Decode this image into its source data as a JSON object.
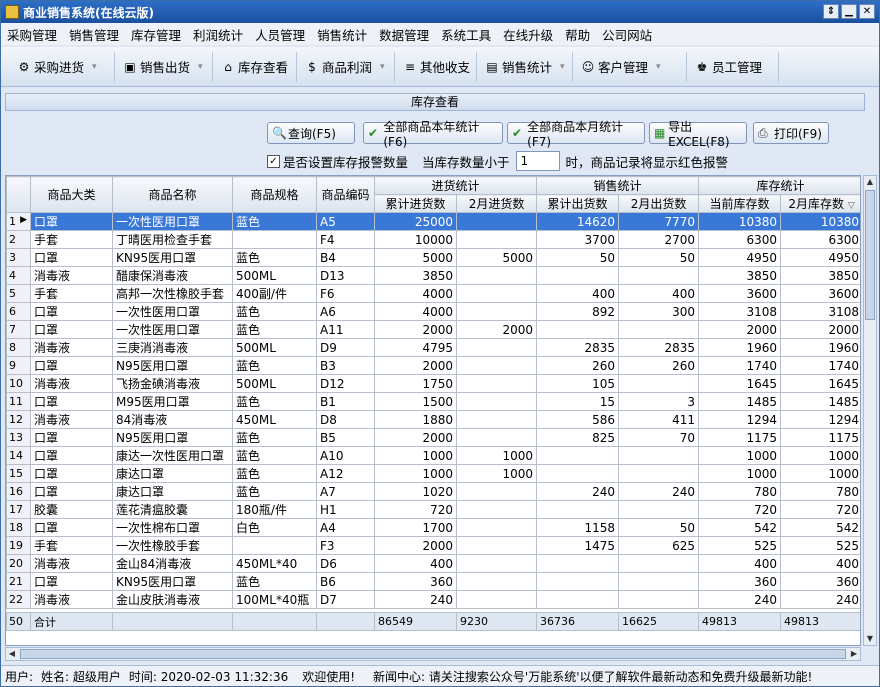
{
  "window": {
    "title": "商业销售系统(在线云版)"
  },
  "menu": [
    "采购管理",
    "销售管理",
    "库存管理",
    "利润统计",
    "人员管理",
    "销售统计",
    "数据管理",
    "系统工具",
    "在线升级",
    "帮助",
    "公司网站"
  ],
  "toolbar": [
    {
      "label": "采购进货",
      "icon": "purchase-icon",
      "glyph": "⚙",
      "dropdown": true
    },
    {
      "label": "销售出货",
      "icon": "sales-icon",
      "glyph": "▣",
      "dropdown": true
    },
    {
      "label": "库存查看",
      "icon": "inventory-icon",
      "glyph": "⌂",
      "dropdown": false
    },
    {
      "label": "商品利润",
      "icon": "profit-icon",
      "glyph": "$",
      "dropdown": true
    },
    {
      "label": "其他收支",
      "icon": "other-io-icon",
      "glyph": "≡",
      "dropdown": false
    },
    {
      "label": "销售统计",
      "icon": "stats-icon",
      "glyph": "▤",
      "dropdown": true
    },
    {
      "label": "客户管理",
      "icon": "customer-icon",
      "glyph": "☺",
      "dropdown": true
    },
    {
      "label": "员工管理",
      "icon": "staff-icon",
      "glyph": "♚",
      "dropdown": false
    }
  ],
  "panel": {
    "title": "库存查看"
  },
  "actions": {
    "query": "查询(F5)",
    "year_stats": "全部商品本年统计(F6)",
    "month_stats": "全部商品本月统计(F7)",
    "export": "导出EXCEL(F8)",
    "print": "打印(F9)"
  },
  "options": {
    "alarm_checkbox_label": "是否设置库存报警数量",
    "alarm_checked": true,
    "threshold_prefix": "当库存数量小于",
    "threshold_value": "1",
    "threshold_suffix": "时，商品记录将显示红色报警"
  },
  "table": {
    "group_headers": [
      "进货统计",
      "销售统计",
      "库存统计"
    ],
    "headers": [
      "商品大类",
      "商品名称",
      "商品规格",
      "商品编码",
      "累计进货数",
      "2月进货数",
      "累计出货数",
      "2月出货数",
      "当前库存数",
      "2月库存数"
    ],
    "rows": [
      [
        "1",
        "口罩",
        "一次性医用口罩",
        "蓝色",
        "A5",
        "25000",
        "",
        "14620",
        "7770",
        "10380",
        "10380"
      ],
      [
        "2",
        "手套",
        "丁晴医用检查手套",
        "",
        "F4",
        "10000",
        "",
        "3700",
        "2700",
        "6300",
        "6300"
      ],
      [
        "3",
        "口罩",
        "KN95医用口罩",
        "蓝色",
        "B4",
        "5000",
        "5000",
        "50",
        "50",
        "4950",
        "4950"
      ],
      [
        "4",
        "消毒液",
        "醋康保消毒液",
        "500ML",
        "D13",
        "3850",
        "",
        "",
        "",
        "3850",
        "3850"
      ],
      [
        "5",
        "手套",
        "高邦一次性橡胶手套",
        "400副/件",
        "F6",
        "4000",
        "",
        "400",
        "400",
        "3600",
        "3600"
      ],
      [
        "6",
        "口罩",
        "一次性医用口罩",
        "蓝色",
        "A6",
        "4000",
        "",
        "892",
        "300",
        "3108",
        "3108"
      ],
      [
        "7",
        "口罩",
        "一次性医用口罩",
        "蓝色",
        "A11",
        "2000",
        "2000",
        "",
        "",
        "2000",
        "2000"
      ],
      [
        "8",
        "消毒液",
        "三庚消消毒液",
        "500ML",
        "D9",
        "4795",
        "",
        "2835",
        "2835",
        "1960",
        "1960"
      ],
      [
        "9",
        "口罩",
        "N95医用口罩",
        "蓝色",
        "B3",
        "2000",
        "",
        "260",
        "260",
        "1740",
        "1740"
      ],
      [
        "10",
        "消毒液",
        "飞扬金碘消毒液",
        "500ML",
        "D12",
        "1750",
        "",
        "105",
        "",
        "1645",
        "1645"
      ],
      [
        "11",
        "口罩",
        "M95医用口罩",
        "蓝色",
        "B1",
        "1500",
        "",
        "15",
        "3",
        "1485",
        "1485"
      ],
      [
        "12",
        "消毒液",
        "84消毒液",
        "450ML",
        "D8",
        "1880",
        "",
        "586",
        "411",
        "1294",
        "1294"
      ],
      [
        "13",
        "口罩",
        "N95医用口罩",
        "蓝色",
        "B5",
        "2000",
        "",
        "825",
        "70",
        "1175",
        "1175"
      ],
      [
        "14",
        "口罩",
        "康达一次性医用口罩",
        "蓝色",
        "A10",
        "1000",
        "1000",
        "",
        "",
        "1000",
        "1000"
      ],
      [
        "15",
        "口罩",
        "康达口罩",
        "蓝色",
        "A12",
        "1000",
        "1000",
        "",
        "",
        "1000",
        "1000"
      ],
      [
        "16",
        "口罩",
        "康达口罩",
        "蓝色",
        "A7",
        "1020",
        "",
        "240",
        "240",
        "780",
        "780"
      ],
      [
        "17",
        "胶囊",
        "莲花清瘟胶囊",
        "180瓶/件",
        "H1",
        "720",
        "",
        "",
        "",
        "720",
        "720"
      ],
      [
        "18",
        "口罩",
        "一次性棉布口罩",
        "白色",
        "A4",
        "1700",
        "",
        "1158",
        "50",
        "542",
        "542"
      ],
      [
        "19",
        "手套",
        "一次性橡胶手套",
        "",
        "F3",
        "2000",
        "",
        "1475",
        "625",
        "525",
        "525"
      ],
      [
        "20",
        "消毒液",
        "金山84消毒液",
        "450ML*40",
        "D6",
        "400",
        "",
        "",
        "",
        "400",
        "400"
      ],
      [
        "21",
        "口罩",
        "KN95医用口罩",
        "蓝色",
        "B6",
        "360",
        "",
        "",
        "",
        "360",
        "360"
      ],
      [
        "22",
        "消毒液",
        "金山皮肤消毒液",
        "100ML*40瓶",
        "D7",
        "240",
        "",
        "",
        "",
        "240",
        "240"
      ]
    ],
    "total": [
      "50",
      "合计",
      "",
      "",
      "",
      "86549",
      "9230",
      "36736",
      "16625",
      "49813",
      "49813"
    ]
  },
  "status": {
    "user": "用户:",
    "name": "姓名: 超级用户",
    "time": "时间: 2020-02-03 11:32:36",
    "welcome": "欢迎使用!",
    "news": "新闻中心: 请关注搜索公众号'万能系统'以便了解软件最新动态和免费升级最新功能!"
  },
  "colors": {
    "selection": "#3a78d8",
    "titlebar": "#2c6fc7"
  }
}
